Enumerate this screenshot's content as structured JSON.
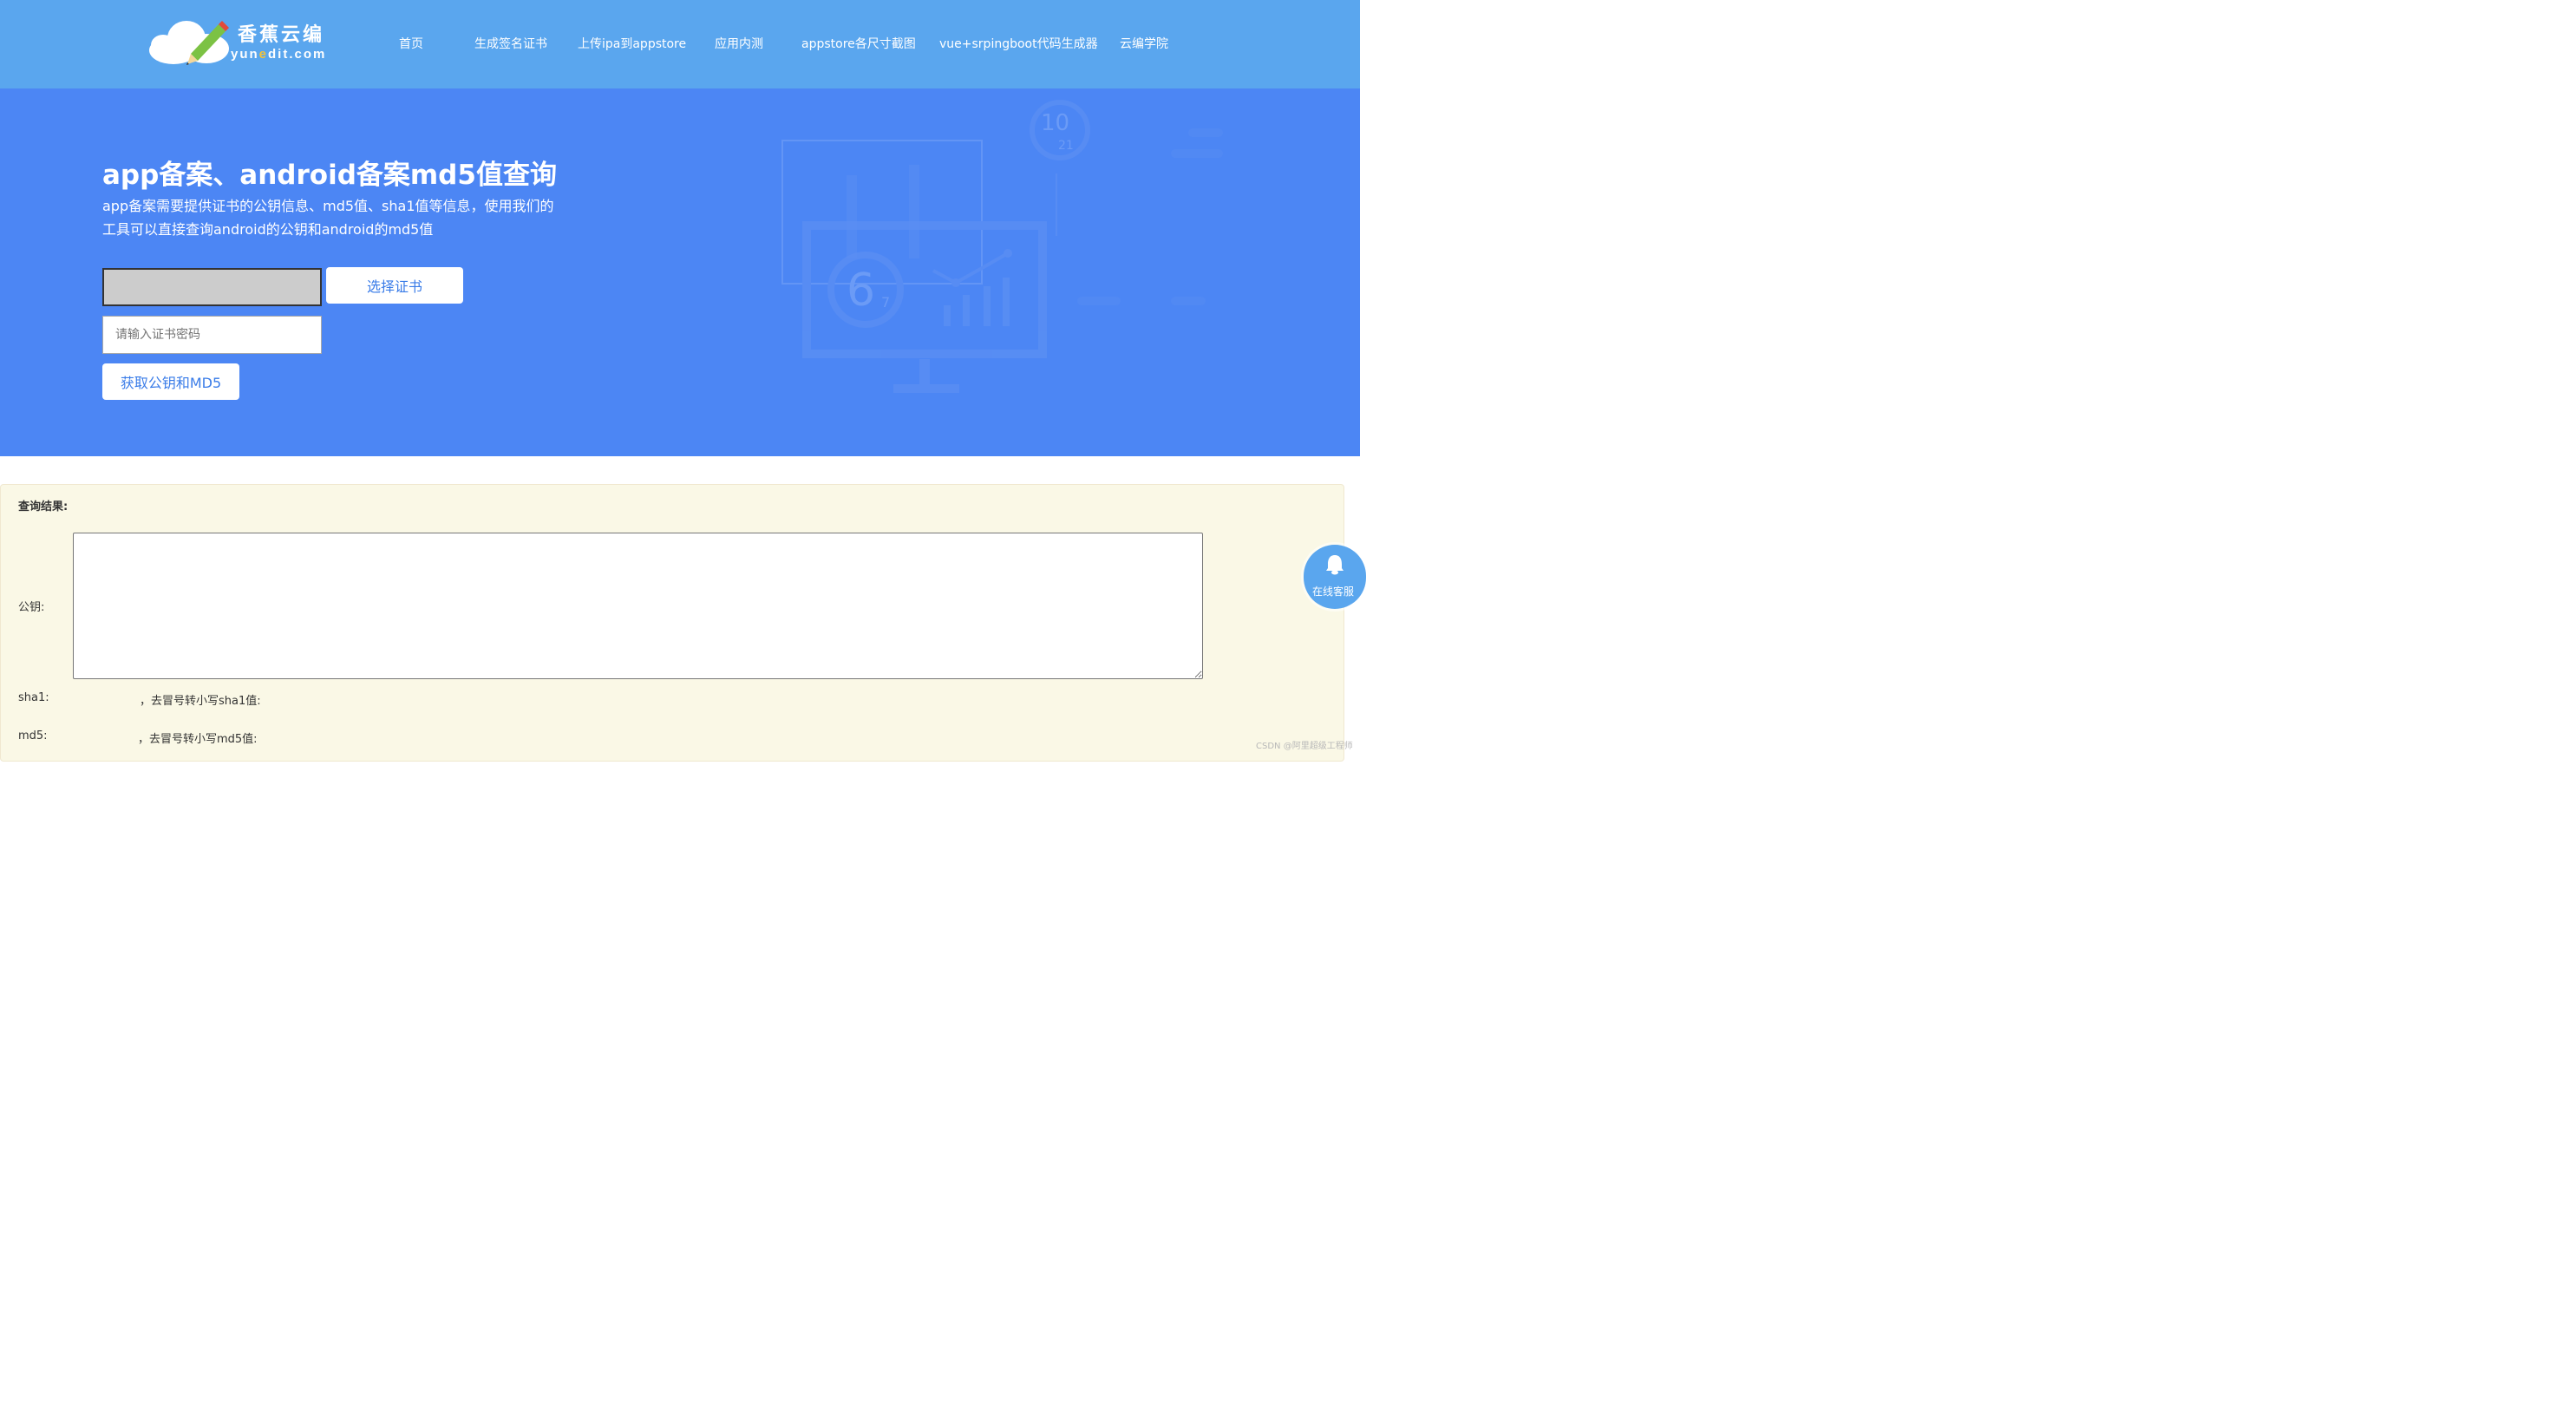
{
  "brand": {
    "name_cn": "香蕉云编",
    "domain_prefix": "yun",
    "domain_highlight": "e",
    "domain_suffix": "dit.com",
    "accent": "#f3c33a"
  },
  "nav": {
    "items": [
      {
        "label": "首页"
      },
      {
        "label": "生成签名证书"
      },
      {
        "label": "上传ipa到appstore"
      },
      {
        "label": "应用内测"
      },
      {
        "label": "appstore各尺寸截图"
      },
      {
        "label": "vue+srpingboot代码生成器"
      },
      {
        "label": "云编学院"
      }
    ]
  },
  "hero": {
    "title": "app备案、android备案md5值查询",
    "description": "app备案需要提供证书的公钥信息、md5值、sha1值等信息，使用我们的工具可以直接查询android的公钥和android的md5值",
    "choose_cert_label": "选择证书",
    "password_placeholder": "请输入证书密码",
    "password_value": "",
    "submit_label": "获取公钥和MD5",
    "bg_color": "#4c86f4",
    "deco_numbers": [
      "10",
      "21",
      "6",
      "7"
    ]
  },
  "result": {
    "heading": "查询结果:",
    "pubkey_label": "公钥:",
    "pubkey_value": "",
    "sha1_label": "sha1:",
    "sha1_value": "",
    "sha1_lower_label": "，去冒号转小写sha1值:",
    "sha1_lower_value": "",
    "md5_label": "md5:",
    "md5_value": "",
    "md5_lower_label": "，去冒号转小写md5值:",
    "md5_lower_value": ""
  },
  "service": {
    "label": "在线客服",
    "icon": "bell-icon"
  },
  "watermark": "CSDN @阿里超级工程师",
  "colors": {
    "header_bg": "#5aa6ee",
    "hero_bg": "#4c86f4",
    "button_text": "#3a7ce8",
    "result_bg": "#faf8e6"
  }
}
